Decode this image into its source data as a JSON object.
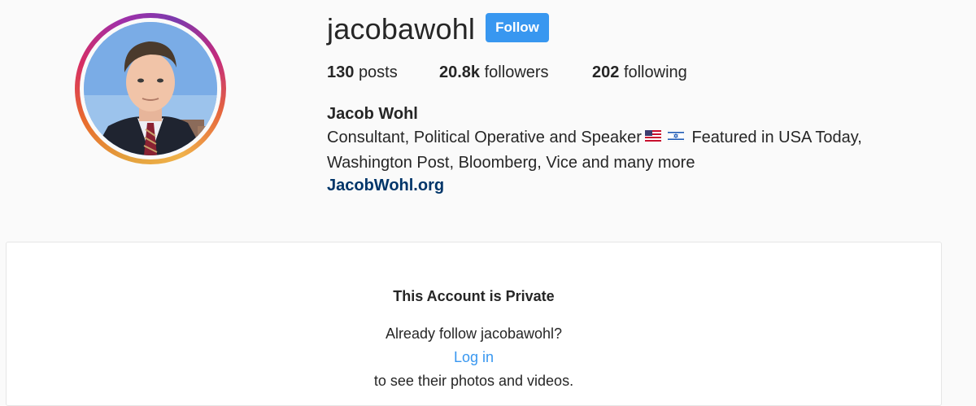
{
  "profile": {
    "username": "jacobawohl",
    "follow_label": "Follow",
    "stats": {
      "posts_count": "130",
      "posts_label": "posts",
      "followers_count": "20.8k",
      "followers_label": "followers",
      "following_count": "202",
      "following_label": "following"
    },
    "full_name": "Jacob Wohl",
    "bio": {
      "line1_part1": "Consultant, Political Operative and Speaker",
      "line1_part2": "Featured in USA Today,",
      "line2": "Washington Post, Bloomberg, Vice and many more",
      "flags": [
        "us-flag-icon",
        "israel-flag-icon"
      ]
    },
    "website": "JacobWohl.org"
  },
  "private_notice": {
    "title": "This Account is Private",
    "question": "Already follow jacobawohl?",
    "login_label": "Log in",
    "subtitle": "to see their photos and videos."
  },
  "colors": {
    "follow_button": "#3897f0",
    "link": "#003569",
    "login_link": "#3897f0",
    "background": "#fafafa",
    "text": "#262626"
  }
}
